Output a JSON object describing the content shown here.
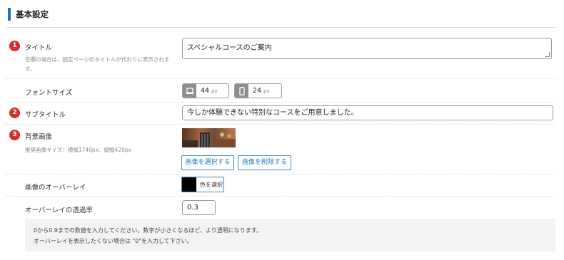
{
  "section": {
    "title": "基本設定"
  },
  "title_field": {
    "num": "1",
    "label": "タイトル",
    "desc": "空欄の場合は、固定ページのタイトルが代わりに表示されます。",
    "value": "スペシャルコースのご案内"
  },
  "font_size": {
    "label": "フォントサイズ",
    "pc": {
      "icon": "laptop-icon",
      "value": "44",
      "unit": "px"
    },
    "sp": {
      "icon": "smartphone-icon",
      "value": "24",
      "unit": "px"
    }
  },
  "subtitle_field": {
    "num": "2",
    "label": "サブタイトル",
    "value": "今しか体験できない特別なコースをご用意しました。"
  },
  "bg_image": {
    "num": "3",
    "label": "背景画像",
    "desc": "推奨画像サイズ：横幅1740px、縦幅420px",
    "select_label": "画像を選択する",
    "delete_label": "画像を削除する"
  },
  "overlay": {
    "label": "画像のオーバーレイ",
    "color": "#000000",
    "color_button_label": "色を選択"
  },
  "opacity": {
    "label": "オーバーレイの透過率",
    "value": "0.3"
  },
  "note": {
    "line1": "0から0.9までの数値を入力してください。数字が小さくなるほど、より透明になります。",
    "line2": "オーバーレイを表示したくない場合は \"0\"を入力して下さい。"
  },
  "colors": {
    "accent": "#1e73be",
    "badge": "#d92b2b",
    "button": "#3f8cc9"
  }
}
